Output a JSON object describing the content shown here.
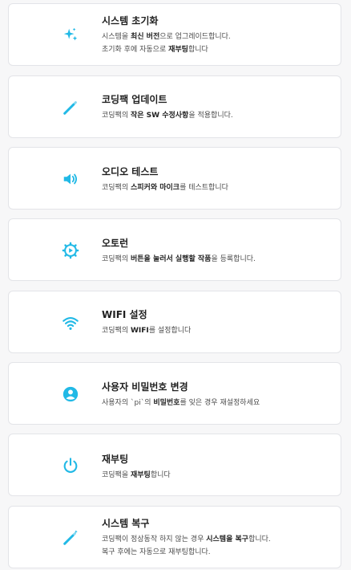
{
  "accent_color": "#21b9e6",
  "items": [
    {
      "title": "시스템 초기화",
      "icon": "sparkles-icon",
      "line1": [
        "시스템을 ",
        "최신 버전",
        "으로 업그레이드합니다."
      ],
      "line2": [
        "초기화 후에 자동으로 ",
        "재부팅",
        "합니다"
      ]
    },
    {
      "title": "코딩팩 업데이트",
      "icon": "magic-wand-icon",
      "line1": [
        "코딩팩의 ",
        "작은 SW 수정사항",
        "을 적용합니다."
      ]
    },
    {
      "title": "오디오 테스트",
      "icon": "speaker-icon",
      "line1": [
        "코딩팩의 ",
        "스피커와 마이크",
        "를 테스트합니다"
      ]
    },
    {
      "title": "오토런",
      "icon": "autorun-gear-icon",
      "line1": [
        "코딩팩의 ",
        "버튼을 눌러서 실행할 작품",
        "을 등록합니다."
      ]
    },
    {
      "title": "WIFI 설정",
      "icon": "wifi-icon",
      "line1": [
        "코딩팩의 ",
        "WIFI",
        "를 설정합니다"
      ]
    },
    {
      "title": "사용자 비밀번호 변경",
      "icon": "user-circle-icon",
      "line1": [
        "사용자의 `pi`의 ",
        "비밀번호",
        "를 잊은 경우 재설정하세요"
      ]
    },
    {
      "title": "재부팅",
      "icon": "power-icon",
      "line1": [
        "코딩팩을 ",
        "재부팅",
        "합니다"
      ]
    },
    {
      "title": "시스템 복구",
      "icon": "magic-wand-icon",
      "line1": [
        "코딩팩이 정상동작 하지 않는 경우 ",
        "시스템을 복구",
        "합니다."
      ],
      "line2": [
        "복구 후에는 자동으로 재부팅합니다."
      ]
    }
  ]
}
